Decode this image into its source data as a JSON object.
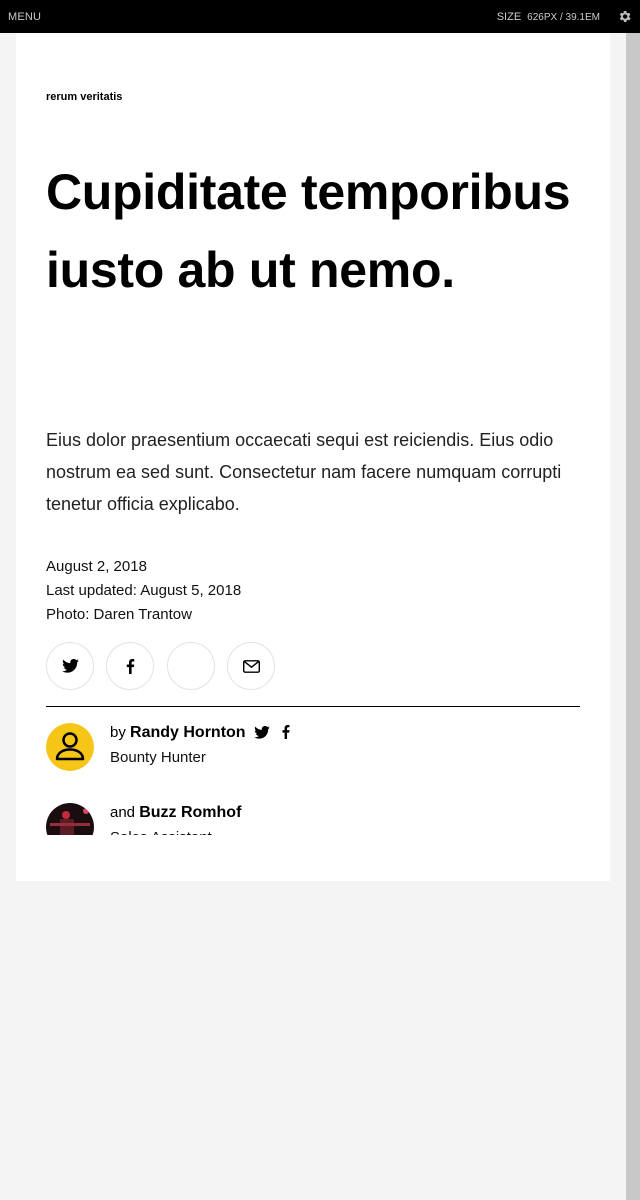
{
  "topbar": {
    "menu_label": "MENU",
    "size_label": "SIZE",
    "size_value": "626PX / 39.1EM",
    "settings_icon": "gear-icon"
  },
  "article": {
    "eyebrow": "rerum veritatis",
    "headline": "Cupiditate temporibus iusto ab ut nemo.",
    "dek": "Eius dolor praesentium occaecati sequi est reiciendis. Eius odio nostrum ea sed sunt. Consectetur nam facere numquam corrupti tenetur officia explicabo.",
    "date": "August 2, 2018",
    "updated": "Last updated: August 5, 2018",
    "photo_credit": "Photo: Daren Trantow",
    "share_icons": [
      "twitter-icon",
      "facebook-icon",
      "blank",
      "mail-icon"
    ]
  },
  "authors": [
    {
      "prefix": "by",
      "name": "Randy Hornton",
      "role": "Bounty Hunter",
      "avatar": "person-placeholder",
      "avatar_color": "#f5c518"
    },
    {
      "prefix": "and",
      "name": "Buzz Romhof",
      "role": "Sales Assistant",
      "avatar": "photo"
    }
  ]
}
